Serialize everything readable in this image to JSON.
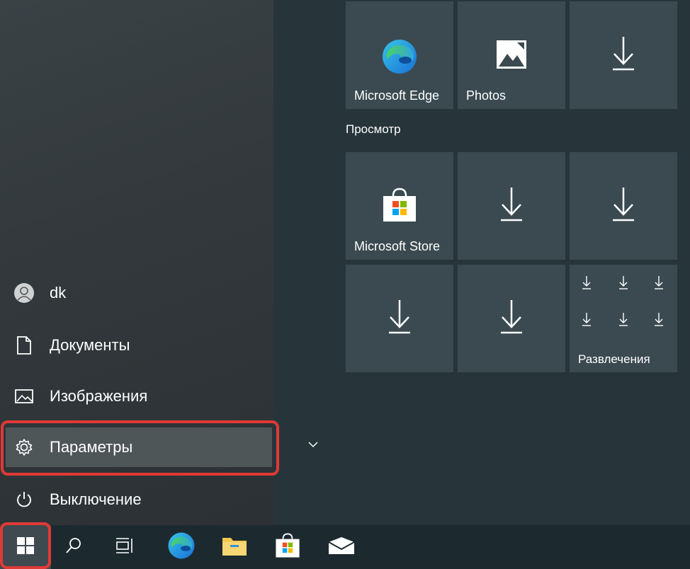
{
  "user": {
    "name": "dk"
  },
  "nav": {
    "documents": "Документы",
    "pictures": "Изображения",
    "settings": "Параметры",
    "power": "Выключение"
  },
  "tiles": {
    "edge": "Microsoft Edge",
    "photos": "Photos",
    "store": "Microsoft Store",
    "entertainment": "Развлечения"
  },
  "groups": {
    "preview": "Просмотр"
  },
  "taskbar": {
    "items": [
      "start-icon",
      "search-icon",
      "task-view-icon",
      "edge-icon",
      "file-explorer-icon",
      "store-icon",
      "mail-icon"
    ]
  },
  "colors": {
    "highlight_box": "#e03a36",
    "tile_bg": "#3b4a51"
  }
}
